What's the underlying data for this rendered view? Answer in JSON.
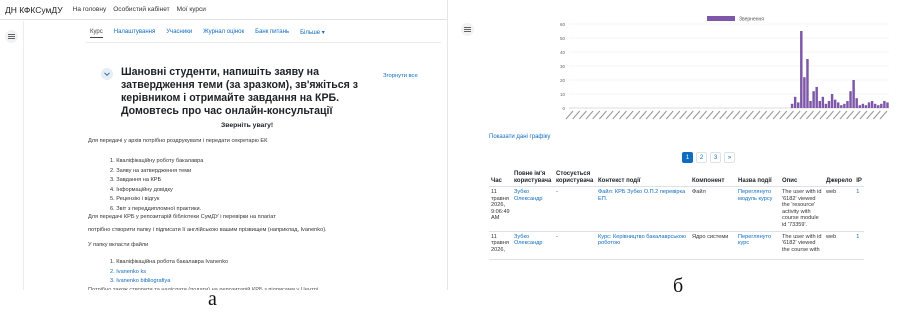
{
  "panel_a": {
    "brand": "ДН КФКСумДУ",
    "nav": [
      "На головну",
      "Особистий кабінет",
      "Мої курси"
    ],
    "tabs": [
      "Курс",
      "Налаштування",
      "Учасники",
      "Журнал оцінок",
      "Банк питань",
      "Більше"
    ],
    "section_title": "Шановні студенти, напишіть заяву на затвердження теми (за зразком), зв'яжіться з керівником і отримайте завдання на КРБ. Домовтесь про час онлайн-консультації",
    "collapse_all": "Згорнути все",
    "attention": "Зверніть увагу!",
    "intro": "Для передачі у архів потрібно роздрукувати і передати секретарю ЕК",
    "list1": [
      "1.  Кваліфікаційну роботу бакалавра",
      "2.  Заяву на затвердження теми",
      "3.  Завдання на КРБ",
      "4.  Інформаційну довідку",
      "5.  Рецензію і відгук",
      "6.  Звіт з переддипломної практики."
    ],
    "para1": "Для передачі КРБ у репозитарій бібліотеки СумДУ і перевірки на плагіат",
    "para2": "потрібно створити папку і підписати її англійською вашим прізвищем (наприклад, Ivanenko).",
    "para3": "У папку вкласти файли",
    "list2": [
      "1.  Кваліфікаційна робота бакалавра  Ivanenko",
      "2.  Ivanenko ks",
      "3.  Ivanenko bibliografiya"
    ],
    "cut_line": "Потрібно також створити та надіслати (подати) на репозитарій КРБ з підписами у Центрі"
  },
  "panel_b": {
    "legend": "Звернення",
    "show_data": "Показати дані графіку",
    "pages": [
      "1",
      "2",
      "3",
      "»"
    ],
    "table": {
      "headers": [
        "Час",
        "Повне ім'я користувача",
        "Стосується користувача",
        "Контекст події",
        "Компонент",
        "Назва події",
        "Опис",
        "Джерело",
        "IP"
      ],
      "rows": [
        [
          "11 травня 2026, 9:06:49 AM",
          "Зубко Олександр",
          "-",
          "Файл: КРБ Зубко О.П.2 перевірка ЕП.",
          "Файл",
          "Переглянуто модуль курсу",
          "The user with id '6182' viewed the 'resource' activity with course module id '73359'.",
          "web",
          "1"
        ],
        [
          "11 травня 2026,",
          "Зубко Олександр",
          "-",
          "Курс: Керівництво бакалаврською роботою",
          "Ядро системи",
          "Переглянуто курс",
          "The user with id '6182' viewed the course with",
          "web",
          "1"
        ]
      ]
    }
  },
  "chart_data": {
    "type": "bar",
    "title": "",
    "legend": [
      "Звернення"
    ],
    "ylim": [
      0,
      60
    ],
    "yticks": [
      0,
      10,
      20,
      30,
      40,
      50,
      60
    ],
    "values": [
      0,
      0,
      0,
      0,
      0,
      0,
      0,
      0,
      0,
      0,
      0,
      0,
      0,
      0,
      0,
      0,
      0,
      0,
      0,
      0,
      0,
      0,
      0,
      0,
      0,
      0,
      0,
      0,
      0,
      0,
      0,
      0,
      0,
      0,
      0,
      0,
      0,
      0,
      0,
      0,
      0,
      0,
      0,
      0,
      0,
      0,
      0,
      0,
      0,
      0,
      0,
      0,
      0,
      0,
      0,
      0,
      0,
      0,
      0,
      0,
      0,
      0,
      0,
      0,
      0,
      0,
      0,
      0,
      0,
      0,
      0,
      0,
      3,
      8,
      4,
      55,
      22,
      35,
      5,
      12,
      15,
      5,
      8,
      3,
      5,
      10,
      6,
      4,
      2,
      3,
      5,
      12,
      20,
      7,
      2,
      3,
      2,
      4,
      5,
      3,
      2,
      3,
      5,
      4
    ],
    "bar_color": "#7e57a8"
  },
  "captions": {
    "a": "а",
    "b": "б"
  }
}
